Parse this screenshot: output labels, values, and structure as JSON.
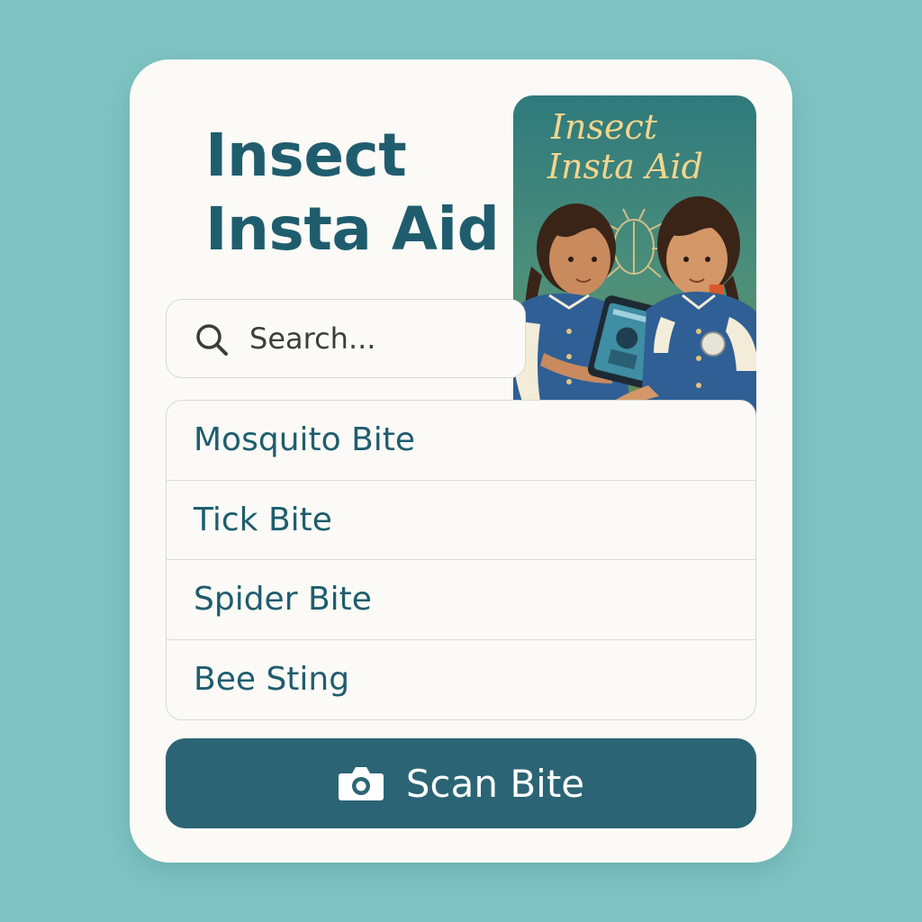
{
  "app": {
    "title_line1": "Insect",
    "title_line2": "Insta Aid"
  },
  "cover": {
    "title_line1": "Insect",
    "title_line2": "Insta Aid"
  },
  "search": {
    "placeholder": "Search...",
    "icon": "search-icon"
  },
  "bite_list": [
    {
      "label": "Mosquito Bite"
    },
    {
      "label": "Tick Bite"
    },
    {
      "label": "Spider Bite"
    },
    {
      "label": "Bee Sting"
    }
  ],
  "scan_button": {
    "label": "Scan Bite",
    "icon": "camera-icon"
  },
  "colors": {
    "background": "#7fc4c3",
    "card": "#fbfaf6",
    "accent": "#1f5d6e",
    "button": "#2b6474",
    "cover_title": "#f3d58e"
  }
}
